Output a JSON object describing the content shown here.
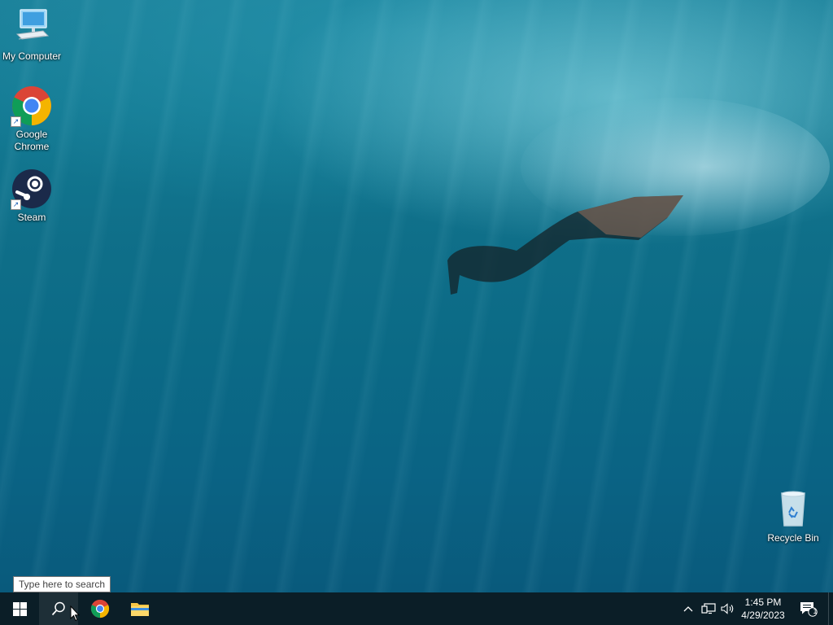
{
  "desktop": {
    "icons": [
      {
        "label": "My Computer",
        "icon": "computer-icon"
      },
      {
        "label": "Google Chrome",
        "icon": "chrome-icon"
      },
      {
        "label": "Steam",
        "icon": "steam-icon"
      },
      {
        "label": "Recycle Bin",
        "icon": "recycle-bin-icon"
      }
    ],
    "wallpaper": "underwater freediver"
  },
  "taskbar": {
    "start_icon": "windows-logo-icon",
    "search_icon": "search-icon",
    "search_tooltip": "Type here to search",
    "pinned": [
      {
        "name": "Google Chrome",
        "icon": "chrome-icon"
      },
      {
        "name": "File Explorer",
        "icon": "folder-icon"
      }
    ],
    "tray": {
      "chevron_icon": "chevron-up-icon",
      "network_icon": "network-icon",
      "volume_icon": "volume-icon",
      "time": "1:45 PM",
      "date": "4/29/2023",
      "notification_icon": "notification-icon",
      "notification_count": "1"
    }
  },
  "colors": {
    "taskbar": "#0b1e27",
    "water": "#0f6f89"
  }
}
